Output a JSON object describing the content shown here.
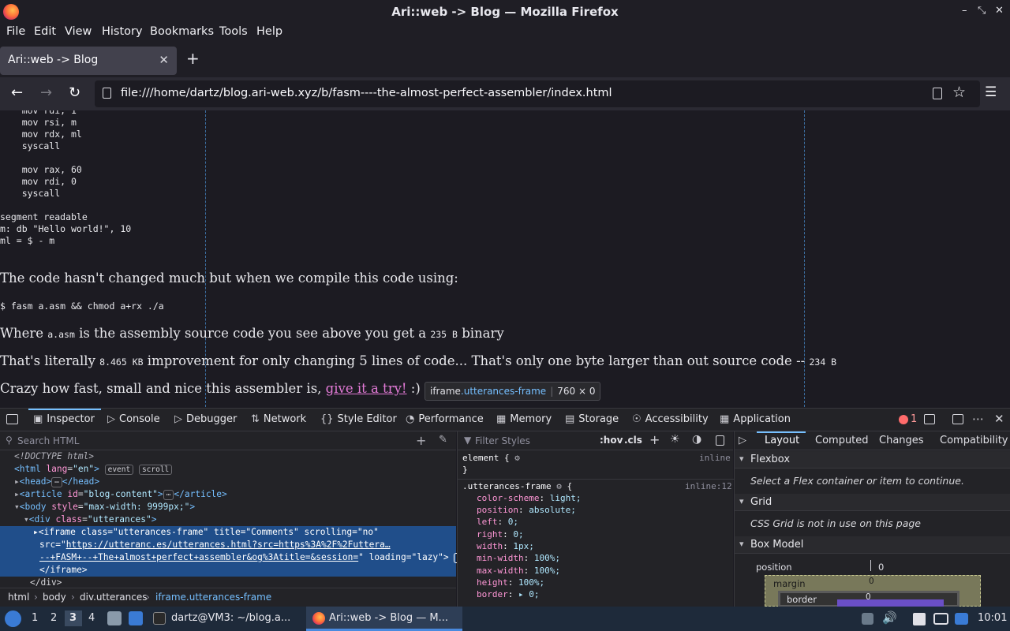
{
  "window": {
    "title": "Ari::web -> Blog — Mozilla Firefox",
    "controls": [
      "–",
      "⤡",
      "✕"
    ]
  },
  "menu": [
    "File",
    "Edit",
    "View",
    "History",
    "Bookmarks",
    "Tools",
    "Help"
  ],
  "tab": {
    "title": "Ari::web -> Blog",
    "close": "✕",
    "new": "+"
  },
  "nav": {
    "url": "file:///home/dartz/blog.ari-web.xyz/b/fasm----the-almost-perfect-assembler/index.html",
    "back": "←",
    "forward": "→",
    "reload": "↻",
    "star": "☆",
    "menu": "☰"
  },
  "content": {
    "code_block": "    mov rdi, 1\n    mov rsi, m\n    mov rdx, ml\n    syscall\n\n    mov rax, 60\n    mov rdi, 0\n    syscall\n\nsegment readable\nm: db \"Hello world!\", 10\nml = $ - m",
    "p1": "The code hasn't changed much but when we compile this code using:",
    "cmd": "$ fasm a.asm && chmod a+rx ./a",
    "p2_a": "Where ",
    "p2_code1": "a.asm",
    "p2_b": " is the assembly source code you see above you get a ",
    "p2_code2": "235 B",
    "p2_c": " binary",
    "p3_a": "That's literally ",
    "p3_code1": "8.465 KB",
    "p3_b": " improvement for only changing 5 lines of code... That's only one byte larger than out source code -- ",
    "p3_code2": "234 B",
    "p4_a": "Crazy how fast, small and nice this assembler is, ",
    "p4_link": "give it a try!",
    "p4_b": " :)",
    "tooltip_tag": "iframe",
    "tooltip_class": ".utterances-frame",
    "tooltip_size": "760 × 0"
  },
  "devtools": {
    "tabs": [
      "Inspector",
      "Console",
      "Debugger",
      "Network",
      "Style Editor",
      "Performance",
      "Memory",
      "Storage",
      "Accessibility",
      "Application"
    ],
    "error_count": "1",
    "search_placeholder": "Search HTML",
    "filter_placeholder": "Filter Styles",
    "hov": ":hov",
    "cls": ".cls",
    "tree": {
      "doctype": "<!DOCTYPE html>",
      "html_open": "<html",
      "html_attr": "lang",
      "html_val": "\"en\"",
      "badge_event": "event",
      "badge_scroll": "scroll",
      "head": "<head>",
      "head_close": "</head>",
      "article_open": "<article",
      "article_attr": "id",
      "article_val": "\"blog-content\"",
      "article_close": "</article>",
      "body_open": "<body",
      "body_attr": "style",
      "body_val": "\"max-width: 9999px;\"",
      "div_open": "<div",
      "div_attr": "class",
      "div_val": "\"utterances\"",
      "iframe_line1": "<iframe class=\"utterances-frame\" title=\"Comments\" scrolling=\"no\"",
      "iframe_src_label": "src=\"",
      "iframe_src_1": "https://utteranc.es/utterances.html?src=https%3A%2F%2Futtera…",
      "iframe_src_2": "--+FASM+--+The+almost+perfect+assembler&og%3Atitle=&session=",
      "iframe_tail": "\" loading=\"lazy\">",
      "iframe_close": "</iframe>",
      "div_close": "</div>"
    },
    "breadcrumbs": [
      "html",
      "body",
      "div.utterances",
      "iframe.utterances-frame"
    ],
    "styles": {
      "element_rule": "element {",
      "element_close": "}",
      "inline": "inline",
      "rule_selector": ".utterances-frame",
      "rule_source": "inline:12",
      "props": [
        {
          "name": "color-scheme",
          "value": "light;"
        },
        {
          "name": "position",
          "value": "absolute;"
        },
        {
          "name": "left",
          "value": "0;"
        },
        {
          "name": "right",
          "value": "0;"
        },
        {
          "name": "width",
          "value": "1px;"
        },
        {
          "name": "min-width",
          "value": "100%;"
        },
        {
          "name": "max-width",
          "value": "100%;"
        },
        {
          "name": "height",
          "value": "100%;"
        },
        {
          "name": "border",
          "value": "▸ 0;"
        }
      ]
    },
    "layout": {
      "tabs": [
        "Layout",
        "Computed",
        "Changes",
        "Compatibility"
      ],
      "flexbox": "Flexbox",
      "flexbox_note": "Select a Flex container or item to continue.",
      "grid": "Grid",
      "grid_note": "CSS Grid is not in use on this page",
      "boxmodel": "Box Model",
      "position": "position",
      "position_val": "0",
      "margin": "margin",
      "margin_val": "0",
      "border": "border",
      "border_val": "0"
    }
  },
  "taskbar": {
    "workspaces": [
      "1",
      "2",
      "3",
      "4"
    ],
    "terminal": "dartz@VM3: ~/blog.a...",
    "firefox": "Ari::web -> Blog — M...",
    "clock": "10:01"
  },
  "colors": {
    "accent": "#75bfff",
    "link": "#e27ad6",
    "selection": "#204e8a"
  }
}
